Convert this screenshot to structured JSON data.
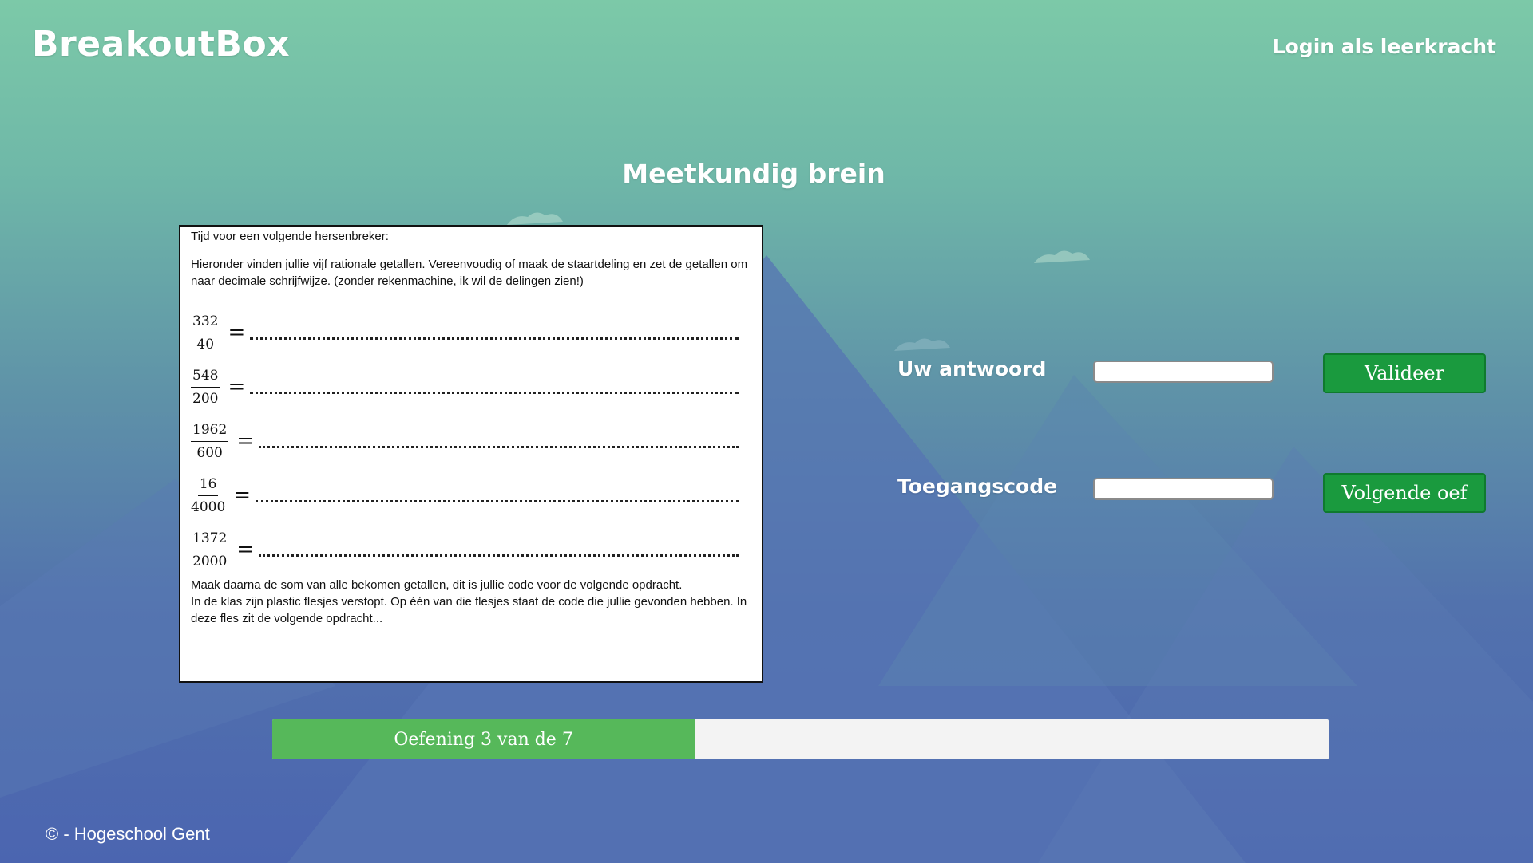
{
  "header": {
    "brand": "BreakoutBox",
    "login_link": "Login als leerkracht"
  },
  "page_title": "Meetkundig brein",
  "exercise": {
    "heading": "Tijd voor een volgende hersenbreker:",
    "intro": "Hieronder vinden jullie vijf rationale getallen. Vereenvoudig of maak de staartdeling en zet de getallen om naar decimale schrijfwijze. (zonder rekenmachine, ik wil de delingen zien!)",
    "fractions": [
      {
        "num": "332",
        "den": "40"
      },
      {
        "num": "548",
        "den": "200"
      },
      {
        "num": "1962",
        "den": "600"
      },
      {
        "num": "16",
        "den": "4000"
      },
      {
        "num": "1372",
        "den": "2000"
      }
    ],
    "equals": "=",
    "outro1": "Maak daarna de som van alle bekomen getallen, dit is jullie code voor de volgende opdracht.",
    "outro2": "In de klas zijn plastic flesjes verstopt. Op één van die flesjes staat de code die jullie gevonden hebben. In deze fles zit de volgende opdracht..."
  },
  "answer": {
    "label": "Uw antwoord",
    "value": "",
    "button": "Valideer"
  },
  "access": {
    "label": "Toegangscode",
    "value": "",
    "button": "Volgende oef"
  },
  "progress": {
    "label": "Oefening 3 van de 7",
    "current": 3,
    "total": 7,
    "fraction": 0.4
  },
  "footer": {
    "text": "©  - Hogeschool Gent"
  },
  "colors": {
    "button_green": "#1a9a3e",
    "progress_green": "#56b85a"
  }
}
